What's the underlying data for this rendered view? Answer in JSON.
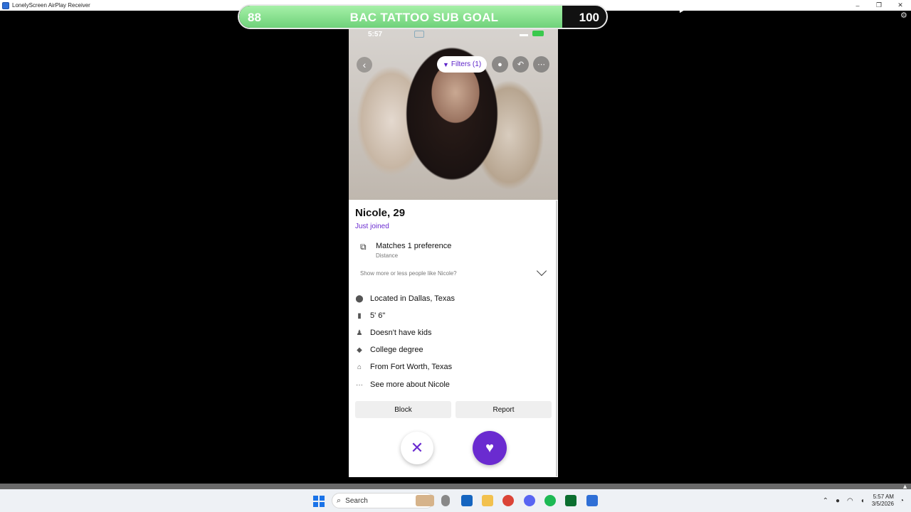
{
  "window": {
    "title": "LonelyScreen AirPlay Receiver",
    "controls": [
      "–",
      "❐",
      "✕"
    ]
  },
  "goal": {
    "start": "88",
    "title": "BAC TATTOO SUB GOAL",
    "end": "100",
    "progress": 0.88
  },
  "phone_status": {
    "time": "5:57"
  },
  "top_controls": {
    "filters_label": "Filters (1)"
  },
  "profile": {
    "name": "Nicole, 29",
    "status": "Just joined",
    "preference_title": "Matches 1 preference",
    "preference_sub": "Distance",
    "show_more": "Show more or less people like Nicole?",
    "attributes": [
      {
        "icon": "location-pin-icon",
        "text": "Located in Dallas, Texas"
      },
      {
        "icon": "height-icon",
        "text": "5' 6\""
      },
      {
        "icon": "kids-icon",
        "text": "Doesn't have kids"
      },
      {
        "icon": "graduation-cap-icon",
        "text": "College degree"
      },
      {
        "icon": "home-icon",
        "text": "From Fort Worth, Texas"
      },
      {
        "icon": "more-dots-icon",
        "text": "See more about Nicole"
      }
    ],
    "block_label": "Block",
    "report_label": "Report"
  },
  "taskbar": {
    "search_label": "Search",
    "time": "5:57 AM",
    "date": "3/5/2026"
  },
  "colors": {
    "accent": "#6a2bd0",
    "goal_fill": "#6fd27a"
  }
}
